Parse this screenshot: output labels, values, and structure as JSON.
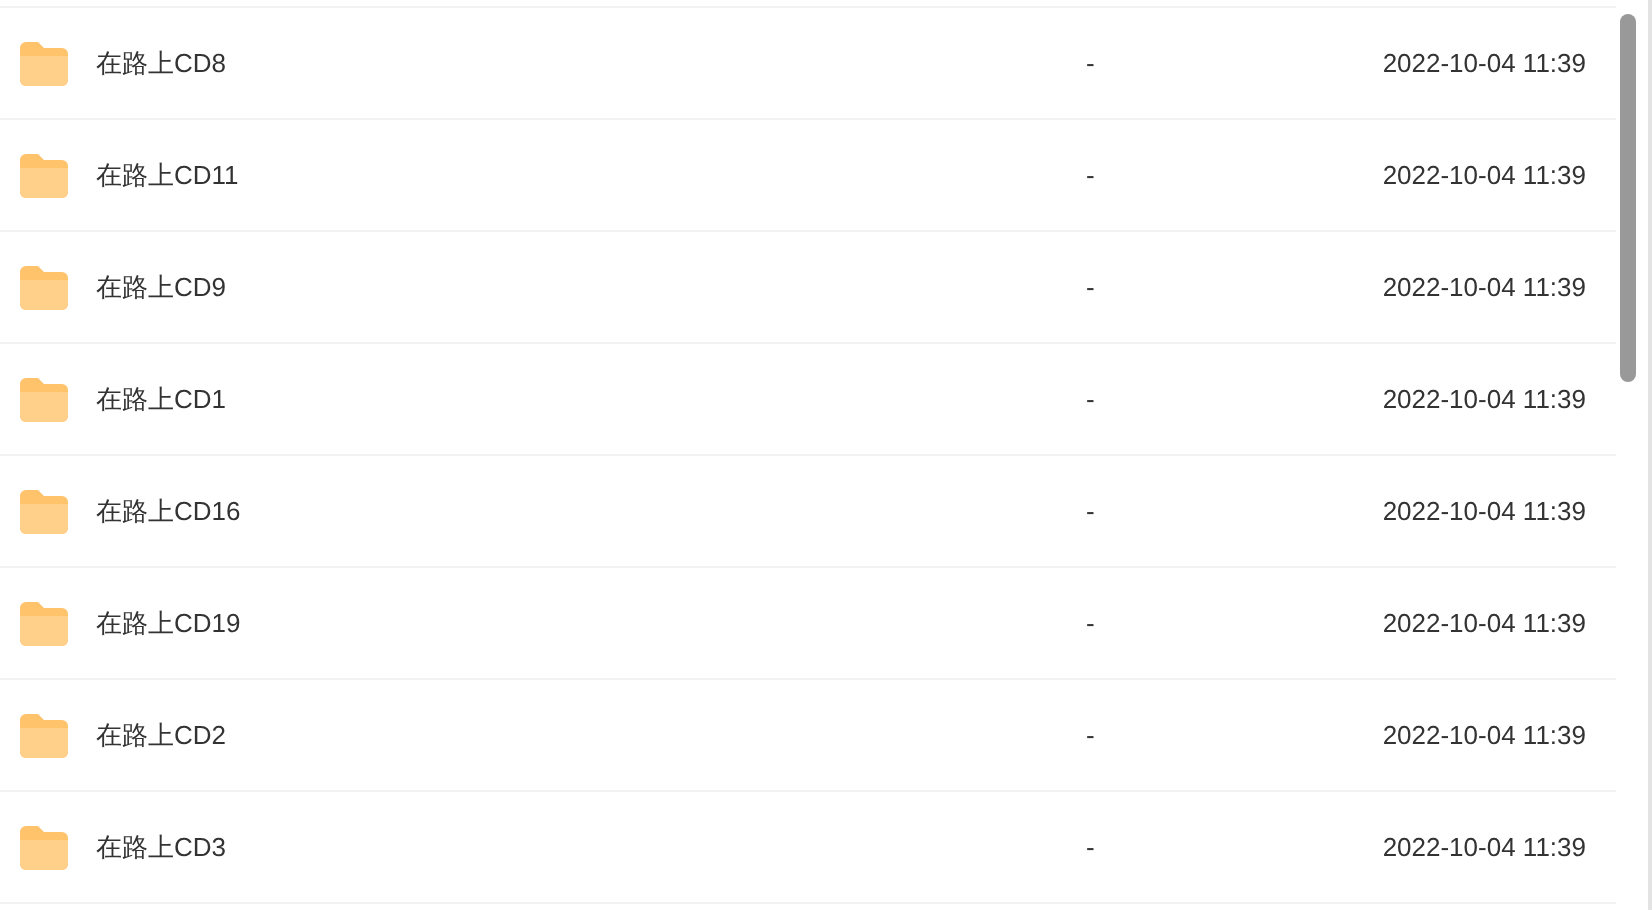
{
  "files": [
    {
      "name": "在路上CD8",
      "size": "-",
      "modified": "2022-10-04 11:39"
    },
    {
      "name": "在路上CD11",
      "size": "-",
      "modified": "2022-10-04 11:39"
    },
    {
      "name": "在路上CD9",
      "size": "-",
      "modified": "2022-10-04 11:39"
    },
    {
      "name": "在路上CD1",
      "size": "-",
      "modified": "2022-10-04 11:39"
    },
    {
      "name": "在路上CD16",
      "size": "-",
      "modified": "2022-10-04 11:39"
    },
    {
      "name": "在路上CD19",
      "size": "-",
      "modified": "2022-10-04 11:39"
    },
    {
      "name": "在路上CD2",
      "size": "-",
      "modified": "2022-10-04 11:39"
    },
    {
      "name": "在路上CD3",
      "size": "-",
      "modified": "2022-10-04 11:39"
    }
  ]
}
